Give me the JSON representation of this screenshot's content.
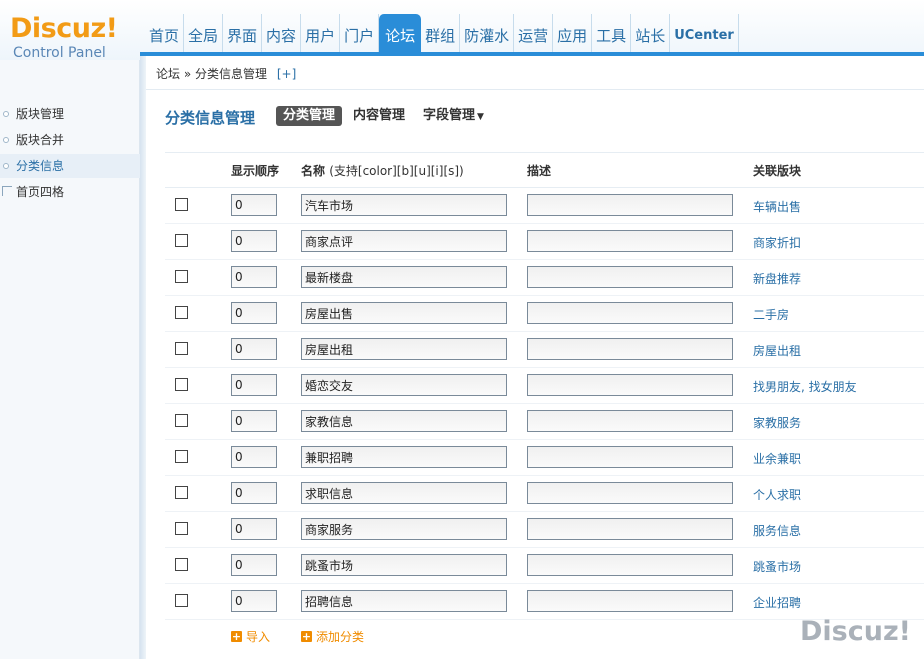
{
  "logo": {
    "title": "Discuz!",
    "subtitle": "Control Panel"
  },
  "topnav": {
    "items": [
      "首页",
      "全局",
      "界面",
      "内容",
      "用户",
      "门户",
      "论坛",
      "群组",
      "防灌水",
      "运营",
      "应用",
      "工具",
      "站长",
      "UCenter"
    ],
    "active": "论坛"
  },
  "breadcrumb": {
    "root": "论坛",
    "separator": "»",
    "current": "分类信息管理",
    "add": "[+]"
  },
  "sidebar": {
    "items": [
      {
        "label": "版块管理"
      },
      {
        "label": "版块合并"
      },
      {
        "label": "分类信息",
        "active": true
      },
      {
        "label": "首页四格"
      }
    ]
  },
  "page": {
    "title": "分类信息管理",
    "tabs": [
      {
        "label": "分类管理",
        "active": true
      },
      {
        "label": "内容管理"
      },
      {
        "label": "字段管理",
        "dropdown": true
      }
    ]
  },
  "table": {
    "headers": {
      "order": "显示顺序",
      "name": "名称",
      "name_hint": "(支持[color][b][u][i][s])",
      "desc": "描述",
      "related": "关联版块"
    },
    "rows": [
      {
        "order": "0",
        "name": "汽车市场",
        "desc": "",
        "related": "车辆出售"
      },
      {
        "order": "0",
        "name": "商家点评",
        "desc": "",
        "related": "商家折扣"
      },
      {
        "order": "0",
        "name": "最新楼盘",
        "desc": "",
        "related": "新盘推荐"
      },
      {
        "order": "0",
        "name": "房屋出售",
        "desc": "",
        "related": "二手房"
      },
      {
        "order": "0",
        "name": "房屋出租",
        "desc": "",
        "related": "房屋出租"
      },
      {
        "order": "0",
        "name": "婚恋交友",
        "desc": "",
        "related": "找男朋友, 找女朋友"
      },
      {
        "order": "0",
        "name": "家教信息",
        "desc": "",
        "related": "家教服务"
      },
      {
        "order": "0",
        "name": "兼职招聘",
        "desc": "",
        "related": "业余兼职"
      },
      {
        "order": "0",
        "name": "求职信息",
        "desc": "",
        "related": "个人求职"
      },
      {
        "order": "0",
        "name": "商家服务",
        "desc": "",
        "related": "服务信息"
      },
      {
        "order": "0",
        "name": "跳蚤市场",
        "desc": "",
        "related": "跳蚤市场"
      },
      {
        "order": "0",
        "name": "招聘信息",
        "desc": "",
        "related": "企业招聘"
      }
    ]
  },
  "actions": {
    "import": "导入",
    "add_category": "添加分类"
  },
  "watermark": "Discuz!",
  "colors": {
    "accent": "#2a8dd8",
    "link": "#2a6fa6",
    "logo": "#f29b16",
    "action": "#f08c00"
  }
}
